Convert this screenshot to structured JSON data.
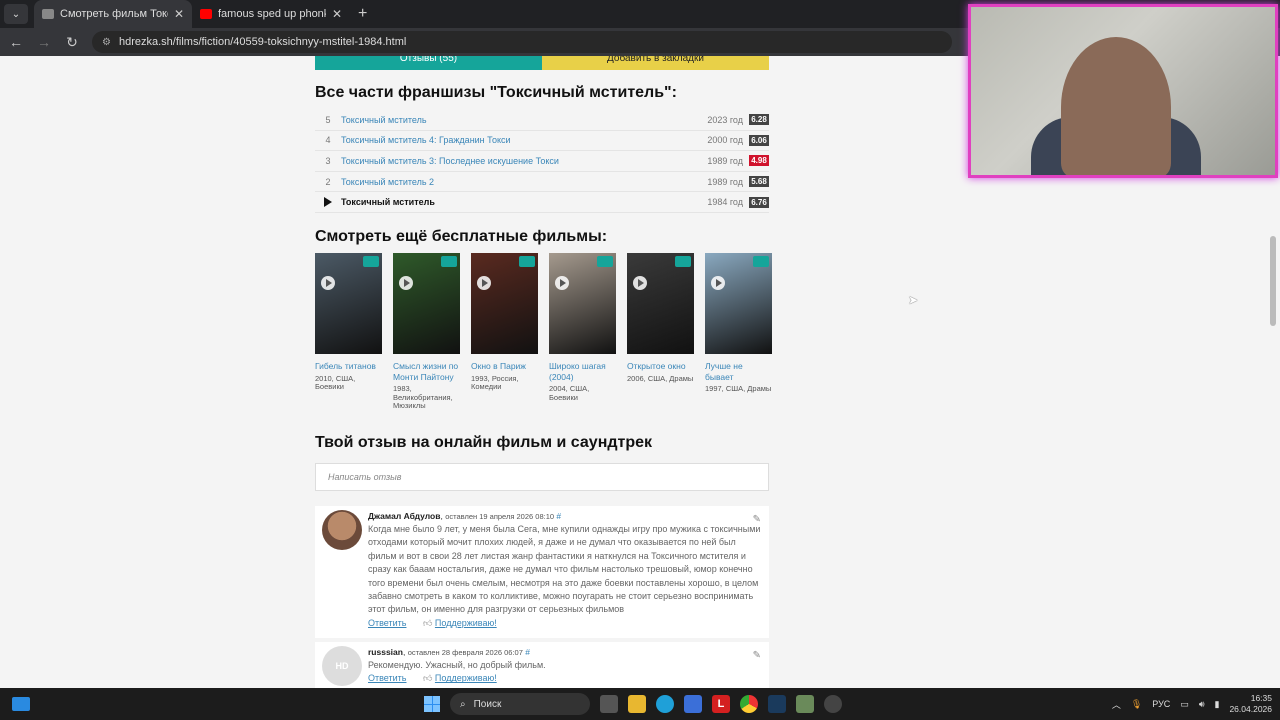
{
  "browser": {
    "tabs": [
      {
        "title": "Смотреть фильм Токсичный м",
        "active": true
      },
      {
        "title": "famous sped up phonk playlist",
        "active": false
      }
    ],
    "url": "hdrezka.sh/films/fiction/40559-toksichnyy-mstitel-1984.html"
  },
  "page": {
    "top_buttons": {
      "reviews": "Отзывы (55)",
      "bookmark": "Добавить в закладки"
    },
    "franchise_heading": "Все части франшизы \"Токсичный мститель\":",
    "franchise": [
      {
        "num": "5",
        "title": "Токсичный мститель",
        "year": "2023 год",
        "rating": "6.28",
        "red": false
      },
      {
        "num": "4",
        "title": "Токсичный мститель 4: Гражданин Токси",
        "year": "2000 год",
        "rating": "6.06",
        "red": false
      },
      {
        "num": "3",
        "title": "Токсичный мститель 3: Последнее искушение Токси",
        "year": "1989 год",
        "rating": "4.98",
        "red": true
      },
      {
        "num": "2",
        "title": "Токсичный мститель 2",
        "year": "1989 год",
        "rating": "5.68",
        "red": false
      },
      {
        "num": "",
        "title": "Токсичный мститель",
        "year": "1984 год",
        "rating": "6.76",
        "red": false
      }
    ],
    "free_heading": "Смотреть ещё бесплатные фильмы:",
    "posters": [
      {
        "title": "Гибель титанов",
        "meta": "2010, США, Боевики",
        "bg": "#4c5a66"
      },
      {
        "title": "Смысл жизни по Монти Пайтону",
        "meta": "1983, Великобритания, Мюзиклы",
        "bg": "#2f5a2a"
      },
      {
        "title": "Окно в Париж",
        "meta": "1993, Россия, Комедии",
        "bg": "#5a2a20"
      },
      {
        "title": "Широко шагая (2004)",
        "meta": "2004, США, Боевики",
        "bg": "#a59a8e"
      },
      {
        "title": "Открытое окно",
        "meta": "2006, США, Драмы",
        "bg": "#3a3a3a"
      },
      {
        "title": "Лучше не бывает",
        "meta": "1997, США, Драмы",
        "bg": "#8aa9c0"
      }
    ],
    "review_heading": "Твой отзыв на онлайн фильм и саундтрек",
    "review_placeholder": "Написать отзыв",
    "comments": [
      {
        "author": "Джамал Абдулов",
        "when": "оставлен 19 апреля 2026 08:10",
        "hash": "#",
        "text": "Когда мне было 9 лет, у меня была Сега, мне купили однажды игру про мужика с токсичными отходами который мочит плохих людей, я даже и не думал что оказывается по ней был фильм и вот в свои 28 лет листая жанр фантастики я наткнулся на Токсичного мстителя и сразу как бааам ностальгия, даже не думал что фильм настолько трешовый, юмор конечно того времени был очень смелым, несмотря на это даже боевки поставлены хорошо, в целом забавно смотреть в каком то колликтиве, можно поугарать не стоит серьезно воспринимать этот фильм, он именно для разгрузки от серьезных фильмов",
        "reply": "Ответить",
        "support": "Поддерживаю!"
      },
      {
        "author": "russsian",
        "when": "оставлен 28 февраля 2026 06:07",
        "hash": "#",
        "text": "Рекомендую. Ужасный, но добрый фильм.",
        "reply": "Ответить",
        "support": "Поддерживаю!"
      }
    ]
  },
  "taskbar": {
    "search": "Поиск",
    "lang": "РУС",
    "time": "16:35",
    "date": "26.04.2026"
  },
  "icons": [
    "chevron-down-icon",
    "close-icon",
    "plus-icon",
    "back-icon",
    "forward-icon",
    "reload-icon",
    "site-info-icon",
    "camera-icon",
    "play-icon",
    "pencil-icon",
    "thumb-up-icon",
    "windows-icon",
    "search-icon"
  ]
}
